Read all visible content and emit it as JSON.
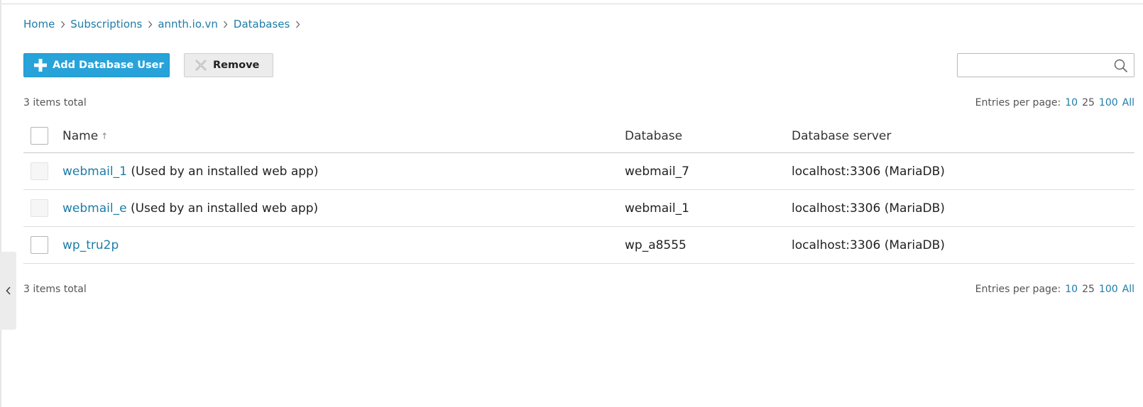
{
  "breadcrumb": [
    {
      "label": "Home"
    },
    {
      "label": "Subscriptions"
    },
    {
      "label": "annth.io.vn"
    },
    {
      "label": "Databases"
    }
  ],
  "toolbar": {
    "add_label": "Add Database User",
    "remove_label": "Remove"
  },
  "search": {
    "value": "",
    "placeholder": ""
  },
  "summary": {
    "total_text": "3 items total",
    "entries_label": "Entries per page:",
    "page_sizes": [
      "10",
      "25",
      "100",
      "All"
    ]
  },
  "table": {
    "headers": {
      "name": "Name",
      "database": "Database",
      "server": "Database server"
    },
    "sort_indicator": "↑",
    "rows": [
      {
        "name": "webmail_1",
        "note": "(Used by an installed web app)",
        "database": "webmail_7",
        "server": "localhost:3306 (MariaDB)",
        "selectable": false
      },
      {
        "name": "webmail_e",
        "note": "(Used by an installed web app)",
        "database": "webmail_1",
        "server": "localhost:3306 (MariaDB)",
        "selectable": false
      },
      {
        "name": "wp_tru2p",
        "note": "",
        "database": "wp_a8555",
        "server": "localhost:3306 (MariaDB)",
        "selectable": true
      }
    ]
  },
  "colors": {
    "accent": "#28a3da",
    "link": "#1e7ca8"
  },
  "icons": {
    "add": "plus-icon",
    "remove": "cross-icon",
    "search": "search-icon",
    "breadcrumb_sep": "chevron-right-icon",
    "sidebar": "chevron-left-icon"
  }
}
